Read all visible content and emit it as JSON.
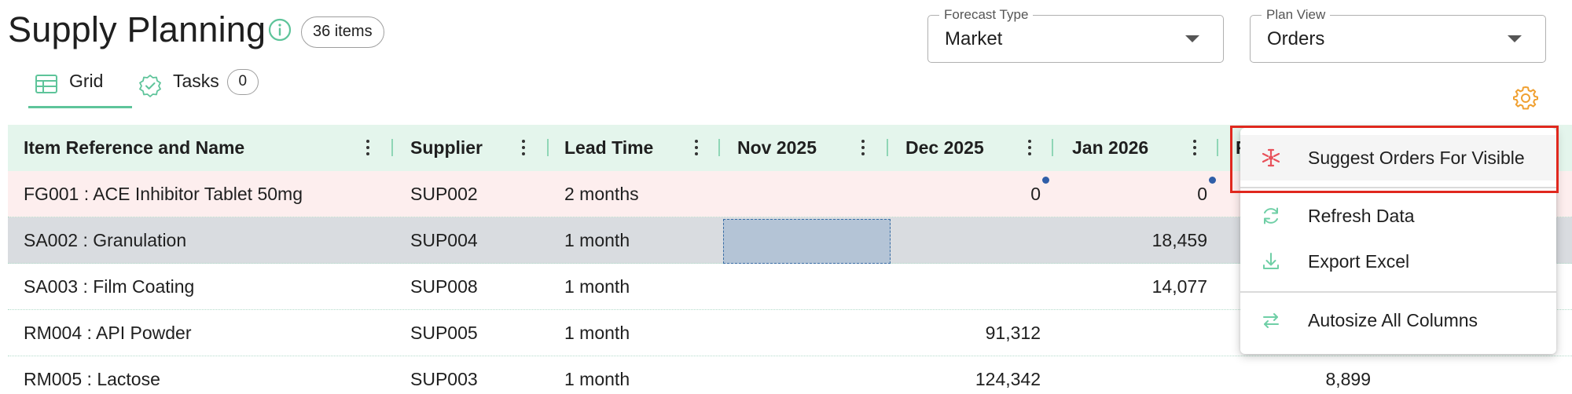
{
  "header": {
    "title": "Supply Planning",
    "items_badge": "36 items"
  },
  "tabs": [
    {
      "label": "Grid",
      "active": true
    },
    {
      "label": "Tasks",
      "count": "0"
    }
  ],
  "forecast_type": {
    "label": "Forecast Type",
    "value": "Market"
  },
  "plan_view": {
    "label": "Plan View",
    "value": "Orders"
  },
  "grid": {
    "columns": [
      "Item Reference and Name",
      "Supplier",
      "Lead Time",
      "Nov 2025",
      "Dec 2025",
      "Jan 2026",
      "F"
    ],
    "rows": [
      {
        "item": "FG001 : ACE Inhibitor Tablet 50mg",
        "supplier": "SUP002",
        "lead_time": "2 months",
        "nov": "",
        "dec": "0",
        "jan": "0",
        "feb": ""
      },
      {
        "item": "SA002 : Granulation",
        "supplier": "SUP004",
        "lead_time": "1 month",
        "nov": "",
        "dec": "",
        "jan": "18,459",
        "feb": ""
      },
      {
        "item": "SA003 : Film Coating",
        "supplier": "SUP008",
        "lead_time": "1 month",
        "nov": "",
        "dec": "",
        "jan": "14,077",
        "feb": ""
      },
      {
        "item": "RM004 : API Powder",
        "supplier": "SUP005",
        "lead_time": "1 month",
        "nov": "",
        "dec": "91,312",
        "jan": "",
        "feb": ""
      },
      {
        "item": "RM005 : Lactose",
        "supplier": "SUP003",
        "lead_time": "1 month",
        "nov": "",
        "dec": "124,342",
        "jan": "",
        "feb": "8,899"
      }
    ]
  },
  "context_menu": {
    "items": [
      {
        "label": "Suggest Orders For Visible",
        "icon": "suggest-orders-icon"
      },
      {
        "label": "Refresh Data",
        "icon": "refresh-icon"
      },
      {
        "label": "Export Excel",
        "icon": "download-icon"
      },
      {
        "label": "Autosize All Columns",
        "icon": "swap-arrows-icon"
      }
    ]
  },
  "colors": {
    "accent_green": "#5ec49a",
    "header_bg": "#e4f5ec",
    "row_error_bg": "#fdeeee",
    "row_selected_bg": "#d9dce0",
    "highlight_red": "#e0281e",
    "gear_orange": "#f0a030",
    "suggest_icon_red": "#e8515a"
  }
}
